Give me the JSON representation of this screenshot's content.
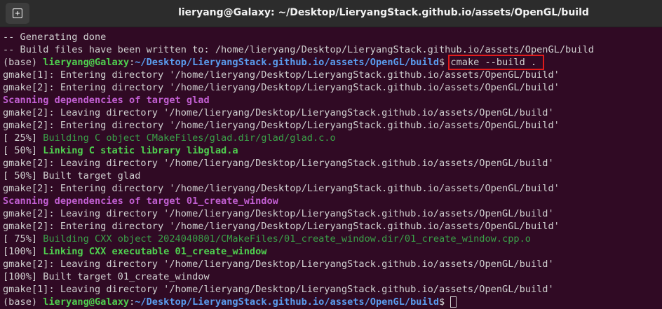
{
  "window": {
    "title": "lieryang@Galaxy: ~/Desktop/LieryangStack.github.io/assets/OpenGL/build"
  },
  "titlebar": {
    "new_tab_icon": "new-tab-icon"
  },
  "terminal": {
    "lines": [
      {
        "kind": "plain",
        "text": "-- Generating done"
      },
      {
        "kind": "plain",
        "text": "-- Build files have been written to: /home/lieryang/Desktop/LieryangStack.github.io/assets/OpenGL/build"
      },
      {
        "kind": "prompt",
        "env": "(base) ",
        "user_host": "lieryang@Galaxy",
        "sep": ":",
        "path": "~/Desktop/LieryangStack.github.io/assets/OpenGL/build",
        "dollar": "$ ",
        "command": "cmake --build . "
      },
      {
        "kind": "plain",
        "text": "gmake[1]: Entering directory '/home/lieryang/Desktop/LieryangStack.github.io/assets/OpenGL/build'"
      },
      {
        "kind": "plain",
        "text": "gmake[2]: Entering directory '/home/lieryang/Desktop/LieryangStack.github.io/assets/OpenGL/build'"
      },
      {
        "kind": "magenta",
        "text": "Scanning dependencies of target glad"
      },
      {
        "kind": "plain",
        "text": "gmake[2]: Leaving directory '/home/lieryang/Desktop/LieryangStack.github.io/assets/OpenGL/build'"
      },
      {
        "kind": "plain",
        "text": "gmake[2]: Entering directory '/home/lieryang/Desktop/LieryangStack.github.io/assets/OpenGL/build'"
      },
      {
        "kind": "progress-dark",
        "prefix": "[ 25%] ",
        "text": "Building C object CMakeFiles/glad.dir/glad/glad.c.o"
      },
      {
        "kind": "progress-bold",
        "prefix": "[ 50%] ",
        "text": "Linking C static library libglad.a"
      },
      {
        "kind": "plain",
        "text": "gmake[2]: Leaving directory '/home/lieryang/Desktop/LieryangStack.github.io/assets/OpenGL/build'"
      },
      {
        "kind": "plain",
        "text": "[ 50%] Built target glad"
      },
      {
        "kind": "plain",
        "text": "gmake[2]: Entering directory '/home/lieryang/Desktop/LieryangStack.github.io/assets/OpenGL/build'"
      },
      {
        "kind": "magenta",
        "text": "Scanning dependencies of target 01_create_window"
      },
      {
        "kind": "plain",
        "text": "gmake[2]: Leaving directory '/home/lieryang/Desktop/LieryangStack.github.io/assets/OpenGL/build'"
      },
      {
        "kind": "plain",
        "text": "gmake[2]: Entering directory '/home/lieryang/Desktop/LieryangStack.github.io/assets/OpenGL/build'"
      },
      {
        "kind": "progress-dark",
        "prefix": "[ 75%] ",
        "text": "Building CXX object 2024040801/CMakeFiles/01_create_window.dir/01_create_window.cpp.o"
      },
      {
        "kind": "progress-bold",
        "prefix": "[100%] ",
        "text": "Linking CXX executable 01_create_window"
      },
      {
        "kind": "plain",
        "text": "gmake[2]: Leaving directory '/home/lieryang/Desktop/LieryangStack.github.io/assets/OpenGL/build'"
      },
      {
        "kind": "plain",
        "text": "[100%] Built target 01_create_window"
      },
      {
        "kind": "plain",
        "text": "gmake[1]: Leaving directory '/home/lieryang/Desktop/LieryangStack.github.io/assets/OpenGL/build'"
      },
      {
        "kind": "prompt-cursor",
        "env": "(base) ",
        "user_host": "lieryang@Galaxy",
        "sep": ":",
        "path": "~/Desktop/LieryangStack.github.io/assets/OpenGL/build",
        "dollar": "$ ",
        "command": ""
      }
    ]
  },
  "colors": {
    "background": "#300a24",
    "prompt_user": "#4fd04f",
    "prompt_path": "#5a9df0",
    "scanning": "#c25fd2",
    "highlight_box": "#e01b1b"
  }
}
